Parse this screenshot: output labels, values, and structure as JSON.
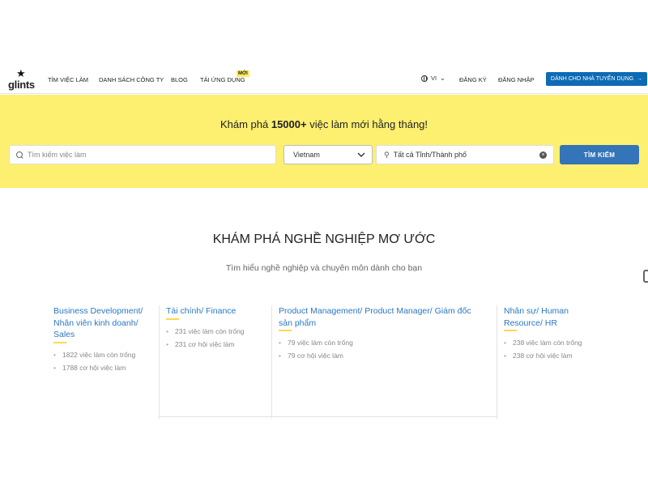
{
  "nav": {
    "logo_text": "glints",
    "links": [
      "TÌM VIỆC LÀM",
      "DANH SÁCH CÔNG TY",
      "BLOG",
      "TẢI ỨNG DỤNG"
    ],
    "new_badge": "MỚI",
    "lang": "VI",
    "register": "ĐĂNG KÝ",
    "login": "ĐĂNG NHẬP",
    "employer_button": "DÀNH CHO NHÀ TUYỂN DỤNG"
  },
  "hero": {
    "title_prefix": "Khám phá ",
    "title_count": "15000+",
    "title_suffix": " việc làm mới hằng tháng!",
    "search_placeholder": "Tìm kiếm việc làm",
    "country": "Vietnam",
    "location": "Tất cả Tỉnh/Thành phố",
    "search_button": "TÌM KIẾM"
  },
  "section": {
    "title": "KHÁM PHÁ NGHỀ NGHIỆP MƠ ƯỚC",
    "subtitle": "Tìm hiểu nghề nghiệp và chuyên môn dành cho bạn"
  },
  "categories": [
    {
      "title": "Business Development/ Nhân viên kinh doanh/ Sales",
      "open_jobs": "1822 việc làm còn trống",
      "opportunities": "1788 cơ hội việc làm"
    },
    {
      "title": "Tài chính/ Finance",
      "open_jobs": "231 việc làm còn trống",
      "opportunities": "231 cơ hội việc làm"
    },
    {
      "title": "Product Management/ Product Manager/ Giám đốc sản phẩm",
      "open_jobs": "79 việc làm còn trống",
      "opportunities": "79 cơ hội việc làm"
    },
    {
      "title": "Nhân sự/ Human Resource/ HR",
      "open_jobs": "238 việc làm còn trống",
      "opportunities": "238 cơ hội việc làm"
    }
  ],
  "colors": {
    "brand_yellow": "#fdf070",
    "primary_blue": "#0e6ab5",
    "link_blue": "#2a78c4"
  }
}
